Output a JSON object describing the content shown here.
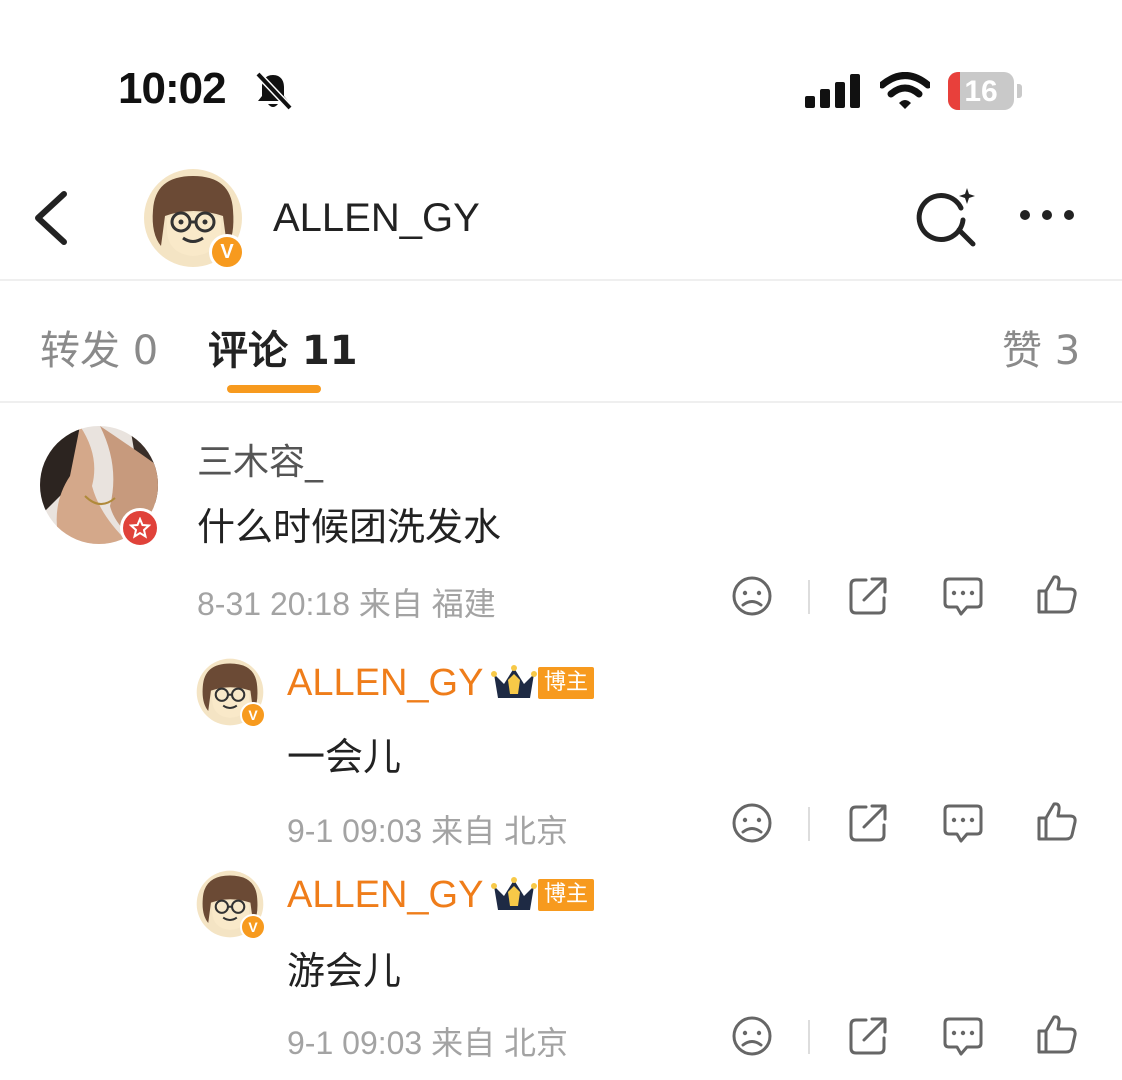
{
  "status_bar": {
    "time": "10:02",
    "battery": "16"
  },
  "header": {
    "name": "ALLEN_GY",
    "verified": "V"
  },
  "tabs": [
    {
      "label": "转发 0",
      "active": false
    },
    {
      "label": "评论 11",
      "active": true
    },
    {
      "label": "赞 3",
      "active": false
    }
  ],
  "comment": {
    "user": "三木容_",
    "text": "什么时候团洗发水",
    "meta": "8-31 20:18 来自 福建",
    "replies": [
      {
        "user": "ALLEN_GY",
        "badge": "博主",
        "text": "一会儿",
        "meta": "9-1 09:03 来自 北京"
      },
      {
        "user": "ALLEN_GY",
        "badge": "博主",
        "text": "游会儿",
        "meta": "9-1 09:03 来自 北京"
      }
    ]
  },
  "colors": {
    "accent": "#f79a1e",
    "name_orange": "#ef7d1a",
    "meta_gray": "#a3a3a3"
  }
}
